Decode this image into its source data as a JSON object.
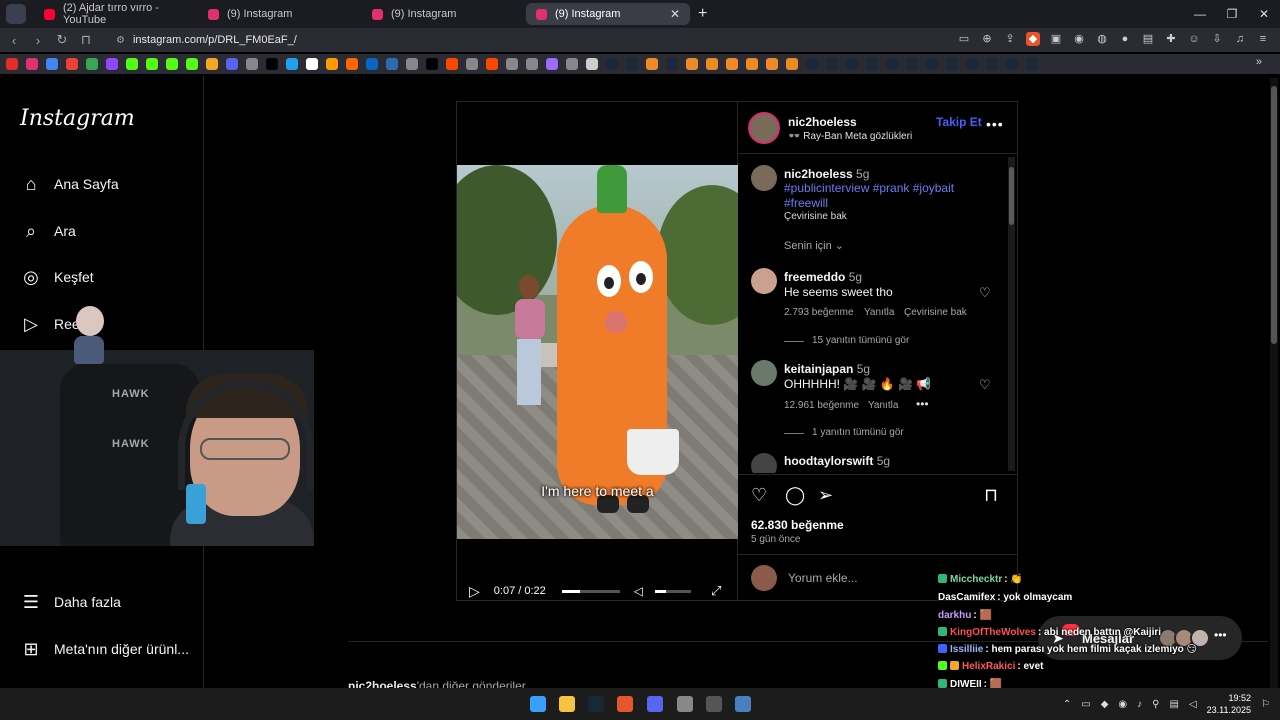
{
  "browser": {
    "tabs": [
      {
        "title": "(2) Ajdar tırro vırro - YouTube",
        "fav_color": "#ff0033",
        "active": false
      },
      {
        "title": "(9) Instagram",
        "fav_color": "#e1306c",
        "active": false
      },
      {
        "title": "(9) Instagram",
        "fav_color": "#e1306c",
        "active": false
      },
      {
        "title": "(9) Instagram",
        "fav_color": "#e1306c",
        "active": true
      }
    ],
    "url": "instagram.com/p/DRL_FM0EaF_/",
    "bookmark_colors": [
      "#e52d27",
      "#e1306c",
      "#4285f4",
      "#ea4335",
      "#34a853",
      "#9146ff",
      "#53fc18",
      "#53fc18",
      "#53fc18",
      "#53fc18",
      "#f5a623",
      "#5865f2",
      "#888888",
      "#000000",
      "#1da1f2",
      "#ffffff",
      "#ff9900",
      "#ff6600",
      "#0a66c2",
      "#2b6cb0",
      "#888888",
      "#000000",
      "#ff4500",
      "#888888",
      "#ff4500",
      "#888888",
      "#888888",
      "#9a6cff",
      "#888888",
      "#cccccc",
      "#1b2838",
      "#1b2838",
      "#f08a24",
      "#1b2838",
      "#f08a24",
      "#f08a24",
      "#f08a24",
      "#f08a24",
      "#f08a24",
      "#f08a24",
      "#1b2838",
      "#1b2838",
      "#1b2838",
      "#1b2838",
      "#1b2838",
      "#1b2838",
      "#1b2838",
      "#1b2838",
      "#1b2838",
      "#1b2838",
      "#1b2838",
      "#1b2838"
    ]
  },
  "sidebar": {
    "logo": "Instagram",
    "items": [
      {
        "label": "Ana Sayfa",
        "icon": "home-icon"
      },
      {
        "label": "Ara",
        "icon": "search-icon"
      },
      {
        "label": "Keşfet",
        "icon": "compass-icon"
      },
      {
        "label": "Reels",
        "icon": "reels-icon"
      }
    ],
    "bottom_items": [
      {
        "label": "Daha fazla",
        "icon": "menu-icon"
      },
      {
        "label": "Meta'nın diğer ürünl...",
        "icon": "apps-icon"
      }
    ],
    "reels_visible_label": "Ree"
  },
  "webcam": {
    "chair_text": "HAWK"
  },
  "post": {
    "author": "nic2hoeless",
    "subtitle": "👓 Ray-Ban Meta gözlükleri",
    "follow_label": "Takip Et",
    "video_subtitle": "I'm here to meet a",
    "timecode": "0:07 / 0:22",
    "progress_fraction": 0.32,
    "volume_fraction": 0.3,
    "caption": {
      "user": "nic2hoeless",
      "time": "5g",
      "tags": "#publicinterview #prank #joybait #freewill",
      "translate": "Çevirisine bak"
    },
    "sort_label": "Senin için",
    "comments": [
      {
        "user": "freemeddo",
        "time": "5g",
        "text": "He seems sweet tho",
        "likes": "2.793 beğenme",
        "reply": "Yanıtla",
        "translate": "Çevirisine bak",
        "replies": "15 yanıtın tümünü gör"
      },
      {
        "user": "keitainjapan",
        "time": "5g",
        "text": "OHHHHH! 🎥 🎥 🔥 🎥 📢",
        "likes": "12.961 beğenme",
        "reply": "Yanıtla",
        "translate": "",
        "replies": "1 yanıtın tümünü gör"
      },
      {
        "user": "hoodtaylorswift",
        "time": "5g",
        "text": "",
        "likes": "",
        "reply": "",
        "translate": "",
        "replies": ""
      }
    ],
    "likes_total": "62.830 beğenme",
    "posted_ago": "5 gün önce",
    "comment_placeholder": "Yorum ekle..."
  },
  "more_posts": {
    "user": "nic2hoeless",
    "suffix": "'dan diğer gönderiler"
  },
  "messages": {
    "label": "Mesajlar"
  },
  "chat": [
    {
      "user": "Micchecktr",
      "color": "#7ad6a0",
      "msg": ": 👏"
    },
    {
      "user": "DasCamifex",
      "color": "#ffffff",
      "msg": ": yok olmaycam"
    },
    {
      "user": "darkhu",
      "color": "#c79bff",
      "msg": ": 🟫"
    },
    {
      "user": "KingOfTheWolves",
      "color": "#ff4f4f",
      "msg": ": abi neden battın @Kaijiri"
    },
    {
      "user": "Issilliie",
      "color": "#9fb4ff",
      "msg": ": hem parası yok hem filmi kaçak izlemiyo 😏"
    },
    {
      "user": "HelixRakici",
      "color": "#ff5a5a",
      "msg": ": evet"
    },
    {
      "user": "DIWEII",
      "color": "#ffffff",
      "msg": ": 🟫"
    }
  ],
  "taskbar": {
    "time": "19:52",
    "date": "23.11.2025"
  }
}
